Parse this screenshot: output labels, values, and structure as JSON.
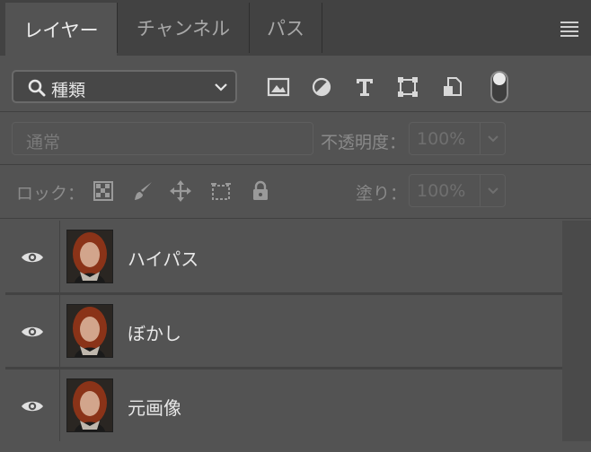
{
  "tabs": [
    {
      "label": "レイヤー",
      "active": true
    },
    {
      "label": "チャンネル",
      "active": false
    },
    {
      "label": "パス",
      "active": false
    }
  ],
  "filter": {
    "label": "種類"
  },
  "blend_mode": {
    "label": "通常"
  },
  "opacity": {
    "label": "不透明度：",
    "value": "100%"
  },
  "lock": {
    "label": "ロック："
  },
  "fill": {
    "label": "塗り：",
    "value": "100%"
  },
  "layers": [
    {
      "name": "ハイパス",
      "visible": true
    },
    {
      "name": "ぼかし",
      "visible": true
    },
    {
      "name": "元画像",
      "visible": true
    }
  ]
}
